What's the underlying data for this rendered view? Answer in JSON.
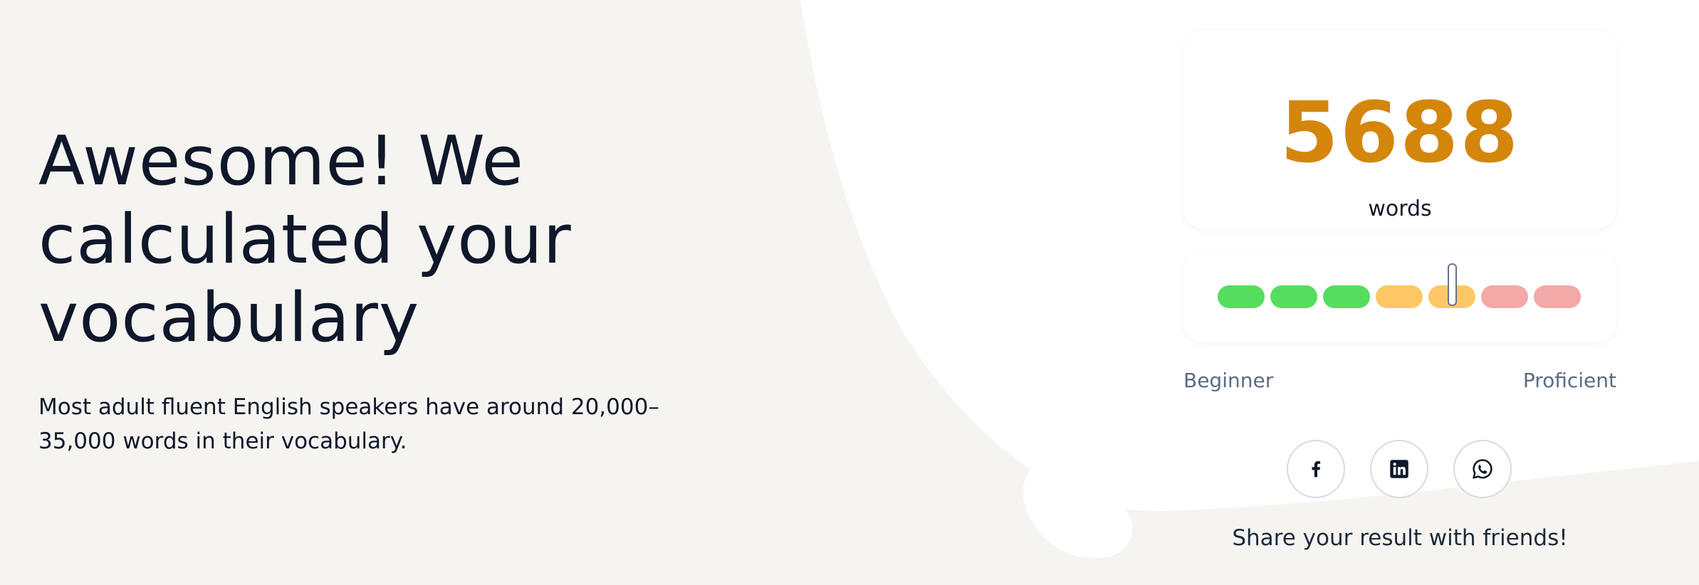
{
  "hero": {
    "headline_lines": [
      "Awesome! We",
      "calculated your",
      "vocabulary"
    ],
    "subtext_lines": [
      "Most adult fluent English speakers have around 20,000–",
      "35,000 words in their vocabulary."
    ]
  },
  "result": {
    "count": "5688",
    "unit": "words"
  },
  "level_scale": {
    "segment_colors": [
      "#56dd5f",
      "#56dd5f",
      "#56dd5f",
      "#fec766",
      "#fec766",
      "#f3a9a6",
      "#f3a9a6"
    ],
    "marker_segment_index": 4,
    "left_label": "Beginner",
    "right_label": "Proficient"
  },
  "share": {
    "buttons": [
      "facebook-icon",
      "linkedin-icon",
      "whatsapp-icon"
    ],
    "caption": "Share your result with friends!"
  },
  "colors": {
    "background": "#f5f4f0",
    "count_accent": "#d4860b",
    "panel": "#ffffff"
  }
}
